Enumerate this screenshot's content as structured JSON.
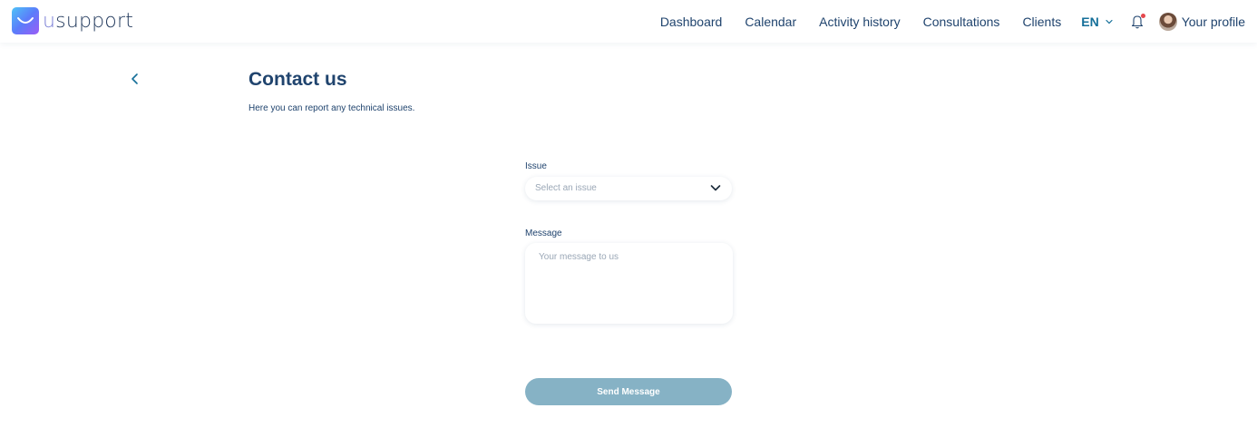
{
  "brand": {
    "name_prefix": "u",
    "name_rest": "support"
  },
  "nav": {
    "items": [
      {
        "label": "Dashboard"
      },
      {
        "label": "Calendar"
      },
      {
        "label": "Activity history"
      },
      {
        "label": "Consultations"
      },
      {
        "label": "Clients"
      }
    ],
    "language": "EN",
    "profile_label": "Your profile"
  },
  "page": {
    "title": "Contact us",
    "subtitle": "Here you can report any technical issues."
  },
  "form": {
    "issue_label": "Issue",
    "issue_placeholder": "Select an issue",
    "message_label": "Message",
    "message_placeholder": "Your message to us",
    "submit_label": "Send Message"
  },
  "icons": {
    "back": "chevron-left-icon",
    "language_dropdown": "chevron-down-icon",
    "notifications": "bell-icon",
    "select_dropdown": "chevron-down-icon"
  },
  "colors": {
    "primary_text": "#20446e",
    "accent": "#156f99",
    "button": "#86b2c5",
    "notification_dot": "#e5484d"
  }
}
